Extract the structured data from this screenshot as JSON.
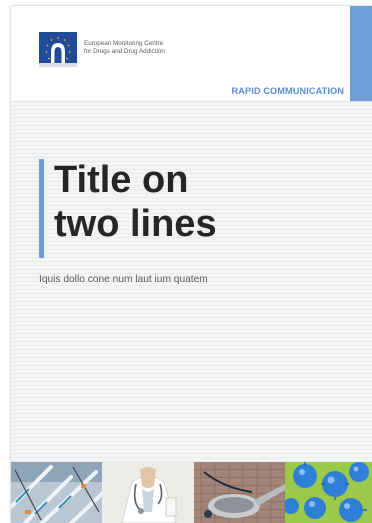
{
  "header": {
    "org_name_line1": "European Monitoring Centre",
    "org_name_line2": "for Drugs and Drug Addiction",
    "series_label": "RAPID COMMUNICATION"
  },
  "cover": {
    "title_line1": "Title on",
    "title_line2": "two lines",
    "subtitle": "Iquis dollo cone num laut ium quatem"
  },
  "colors": {
    "accent_blue": "#6e9fd8",
    "logo_blue": "#1f4b9a",
    "title_text": "#262626"
  },
  "photos": [
    {
      "icon": "syringes-photo-icon"
    },
    {
      "icon": "doctor-stethoscope-photo-icon"
    },
    {
      "icon": "spoon-drug-paraphernalia-photo-icon"
    },
    {
      "icon": "virus-microscopy-photo-icon"
    }
  ]
}
